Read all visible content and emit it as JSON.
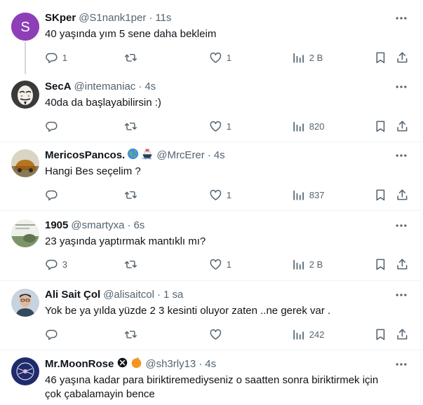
{
  "tweets": [
    {
      "name": "SKper",
      "handle": "@S1nank1per",
      "separator": "·",
      "time": "11s",
      "text": "40 yaşında yım 5 sene daha bekleim",
      "avatar_letter": "S",
      "avatar_color": "#8e3fb7",
      "reply_count": "1",
      "retweet_count": "",
      "like_count": "1",
      "view_count": "2 B"
    },
    {
      "name": "SecA",
      "handle": "@intemaniac",
      "separator": "·",
      "time": "4s",
      "text": "40da da başlayabilirsin :)",
      "reply_count": "",
      "retweet_count": "",
      "like_count": "1",
      "view_count": "820"
    },
    {
      "name": "MericosPancos.",
      "handle": "@MrcErer",
      "separator": "·",
      "time": "4s",
      "text": "Hangi Bes seçelim ?",
      "reply_count": "",
      "retweet_count": "",
      "like_count": "1",
      "view_count": "837"
    },
    {
      "name": "1905",
      "handle": "@smartyxa",
      "separator": "·",
      "time": "6s",
      "text": "23 yaşında yaptırmak mantıklı mı?",
      "reply_count": "3",
      "retweet_count": "",
      "like_count": "1",
      "view_count": "2 B"
    },
    {
      "name": "Ali Sait Çol",
      "handle": "@alisaitcol",
      "separator": "·",
      "time": "1 sa",
      "text": "Yok be ya yılda yüzde 2 3 kesinti oluyor zaten ..ne gerek var .",
      "reply_count": "",
      "retweet_count": "",
      "like_count": "",
      "view_count": "242"
    },
    {
      "name": "Mr.MoonRose",
      "handle": "@sh3rly13",
      "separator": "·",
      "time": "4s",
      "text_line1": "46 yaşına kadar para biriktiremediyseniz o saatten sonra biriktirmek için",
      "text_line2": "çok çabalamayin bence"
    }
  ],
  "colors": {
    "text": "#0f1419",
    "secondary": "#536471",
    "divider": "#eff3f4",
    "thread_line": "#cfd9de",
    "orange_badge": "#f7931e"
  },
  "icons": [
    "more-icon",
    "reply-icon",
    "retweet-icon",
    "like-icon",
    "views-icon",
    "bookmark-icon",
    "share-icon",
    "earth-globe-icon",
    "ship-icon",
    "verified-x-icon",
    "orange-circle-icon"
  ]
}
